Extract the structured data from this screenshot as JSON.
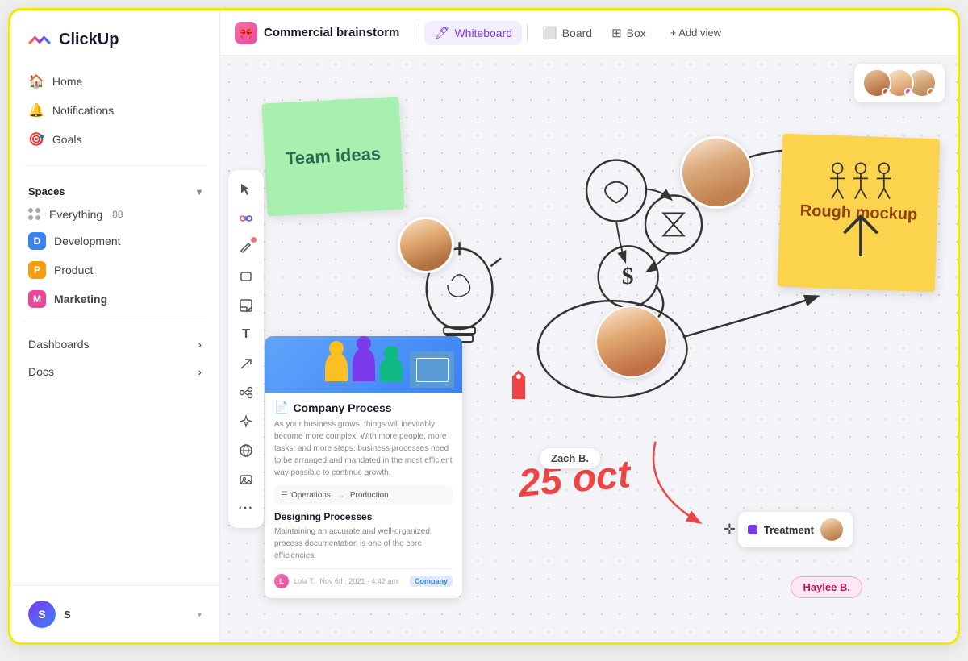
{
  "app": {
    "name": "ClickUp"
  },
  "sidebar": {
    "nav": [
      {
        "label": "Home",
        "icon": "🏠"
      },
      {
        "label": "Notifications",
        "icon": "🔔"
      },
      {
        "label": "Goals",
        "icon": "🎯"
      }
    ],
    "spaces_label": "Spaces",
    "spaces": [
      {
        "label": "Everything",
        "count": "88",
        "color": "#aaa",
        "type": "grid"
      },
      {
        "label": "Development",
        "color": "#3b82f6",
        "letter": "D"
      },
      {
        "label": "Product",
        "color": "#f59e0b",
        "letter": "P"
      },
      {
        "label": "Marketing",
        "color": "#ec4899",
        "letter": "M"
      }
    ],
    "dashboards_label": "Dashboards",
    "docs_label": "Docs",
    "user": {
      "initial": "S"
    }
  },
  "topbar": {
    "project_name": "Commercial brainstorm",
    "project_icon": "🎀",
    "tabs": [
      {
        "label": "Whiteboard",
        "icon": "🖊",
        "active": true
      },
      {
        "label": "Board",
        "icon": "⬜",
        "active": false
      },
      {
        "label": "Box",
        "icon": "⊞",
        "active": false
      }
    ],
    "add_view": "+ Add view"
  },
  "canvas": {
    "sticky_green": "Team ideas",
    "sticky_yellow": "Rough mockup",
    "handwritten_date": "25 oct",
    "zach_label": "Zach B.",
    "haylee_label": "Haylee B.",
    "treatment_label": "Treatment"
  },
  "doc_card": {
    "title": "Company Process",
    "description": "As your business grows, things will inevitably become more complex. With more people, more tasks, and more steps, business processes need to be arranged and mandated in the most efficient way possible to continue growth.",
    "flow_from": "Operations",
    "flow_to": "Production",
    "section_title": "Designing Processes",
    "section_desc": "Maintaining an accurate and well-organized process documentation is one of the core efficiencies.",
    "author": "Lola T.",
    "date": "Nov 6th, 2021 · 4:42 am",
    "tag": "Company"
  },
  "tools": [
    {
      "icon": "↗",
      "name": "select-tool"
    },
    {
      "icon": "✏",
      "name": "draw-tool",
      "dot": "red"
    },
    {
      "icon": "⬜",
      "name": "shape-tool",
      "dot": "blue"
    },
    {
      "icon": "📋",
      "name": "sticky-tool"
    },
    {
      "icon": "T",
      "name": "text-tool"
    },
    {
      "icon": "↗",
      "name": "arrow-tool"
    },
    {
      "icon": "⊕",
      "name": "connect-tool"
    },
    {
      "icon": "✦",
      "name": "ai-tool"
    },
    {
      "icon": "🌐",
      "name": "embed-tool"
    },
    {
      "icon": "🖼",
      "name": "media-tool"
    },
    {
      "icon": "…",
      "name": "more-tool"
    }
  ]
}
